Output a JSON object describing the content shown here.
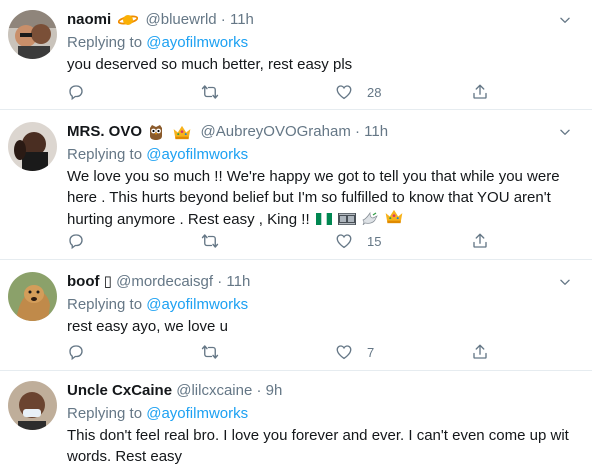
{
  "replying_to_label": "Replying to",
  "tweets": [
    {
      "name": "naomi",
      "handle": "@bluewrld",
      "time": "11h",
      "replying_to": "@ayofilmworks",
      "text": "you deserved so much better, rest easy pls",
      "reply_count": "",
      "retweet_count": "",
      "like_count": "28"
    },
    {
      "name": "MRS. OVO",
      "handle": "@AubreyOVOGraham",
      "time": "11h",
      "replying_to": "@ayofilmworks",
      "text": "We love you so much !! We're happy we got to tell you that while you were here . This hurts beyond belief but I'm so fulfilled to know that YOU aren't hurting anymore . Rest easy , King !!",
      "reply_count": "",
      "retweet_count": "",
      "like_count": "15"
    },
    {
      "name": "boof",
      "name_glyph": "▯",
      "handle": "@mordecaisgf",
      "time": "11h",
      "replying_to": "@ayofilmworks",
      "text": "rest easy ayo, we love u",
      "reply_count": "",
      "retweet_count": "",
      "like_count": "7"
    },
    {
      "name": "Uncle CxCaine",
      "handle": "@lilcxcaine",
      "time": "9h",
      "replying_to": "@ayofilmworks",
      "text": "This don't feel real bro. I love you forever and ever. I can't even come up wit words. Rest easy"
    }
  ],
  "separator": "·",
  "colors": {
    "link": "#1da1f2",
    "muted": "#657786",
    "border": "#e6ecf0"
  }
}
